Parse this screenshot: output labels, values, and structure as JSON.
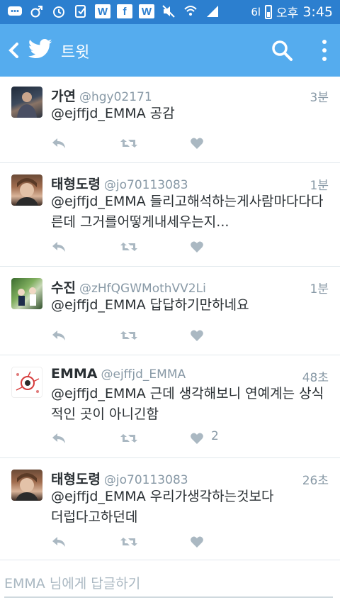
{
  "status_bar": {
    "signal_text": "6l",
    "ampm": "오후",
    "time": "3:45"
  },
  "app_bar": {
    "title": "트윗"
  },
  "tweets": [
    {
      "name": "가연",
      "handle": "@hgy02171",
      "time": "3분",
      "text": "@ejffjd_EMMA 공감",
      "likes": ""
    },
    {
      "name": "태형도령",
      "handle": "@jo70113083",
      "time": "1분",
      "text": "@ejffjd_EMMA 들리고해석하는게사람마다다다른데 그거를어떻게내세우는지...",
      "likes": ""
    },
    {
      "name": "수진",
      "handle": "@zHfQGWMothVV2Li",
      "time": "1분",
      "text": "@ejffjd_EMMA 답답하기만하네요",
      "likes": ""
    },
    {
      "name": "EMMA",
      "handle": "@ejffjd_EMMA",
      "time": "48초",
      "text": "@ejffjd_EMMA 근데 생각해보니 연예계는 상식적인 곳이 아니긴함",
      "likes": "2"
    },
    {
      "name": "태형도령",
      "handle": "@jo70113083",
      "time": "26초",
      "text": "@ejffjd_EMMA 우리가생각하는것보다더럽다고하던데",
      "likes": ""
    }
  ],
  "reply": {
    "placeholder": "EMMA 님에게 답글하기"
  },
  "colors": {
    "status_bar": "#2c7fcf",
    "app_bar": "#55acee",
    "action_icon": "#aab8c2",
    "secondary_text": "#8899a6"
  }
}
